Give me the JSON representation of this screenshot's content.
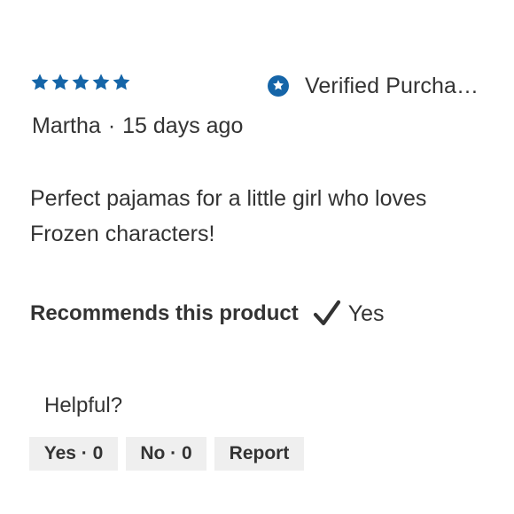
{
  "review": {
    "rating": 5,
    "rating_max": 5,
    "star_color": "#1565a8",
    "verified_label": "Verified Purchaser",
    "verified_icon": "star-badge-icon",
    "author": "Martha",
    "separator": "·",
    "date": "15 days ago",
    "body": "Perfect pajamas for a little girl who loves Frozen characters!",
    "recommend_label": "Recommends this product",
    "recommend_icon": "checkmark-icon",
    "recommend_value": "Yes"
  },
  "feedback": {
    "helpful_label": "Helpful?",
    "yes_label": "Yes · 0",
    "no_label": "No · 0",
    "report_label": "Report",
    "button_bg": "#efefef"
  }
}
